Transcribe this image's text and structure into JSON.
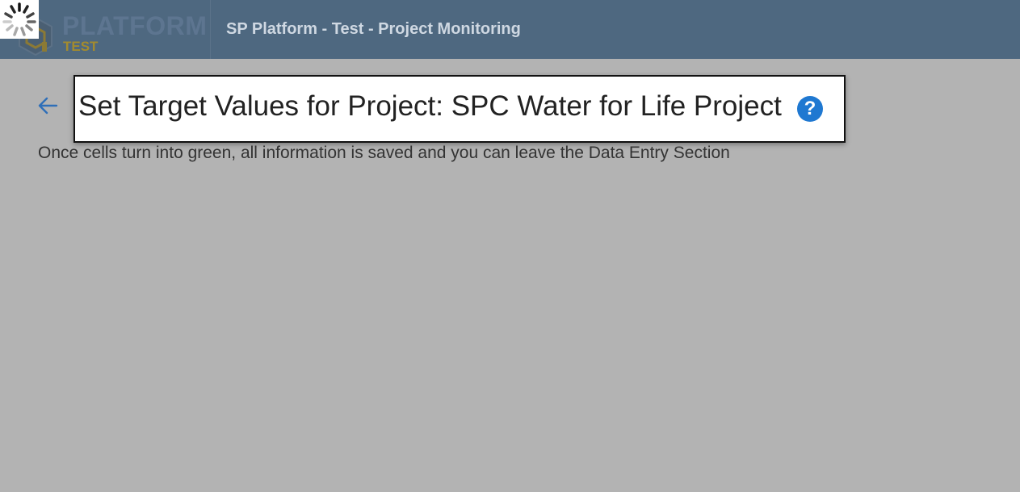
{
  "header": {
    "logo_text": "PLATFORM",
    "logo_sub": "TEST",
    "app_title": "SP Platform - Test - Project Monitoring"
  },
  "page": {
    "title": "Set Target Values for Project: SPC Water for Life Project",
    "hint": "Once cells turn into green, all information is saved and you can leave the Data Entry Section",
    "help_glyph": "?",
    "back_icon": "arrow-left-icon",
    "help_icon": "question-circle-icon",
    "spinner_icon": "loading-spinner-icon"
  },
  "colors": {
    "topbar": "#4e6880",
    "overlay": "#b3b3b3",
    "accent": "#1f78d1",
    "logo_gold": "#a38b2e"
  }
}
